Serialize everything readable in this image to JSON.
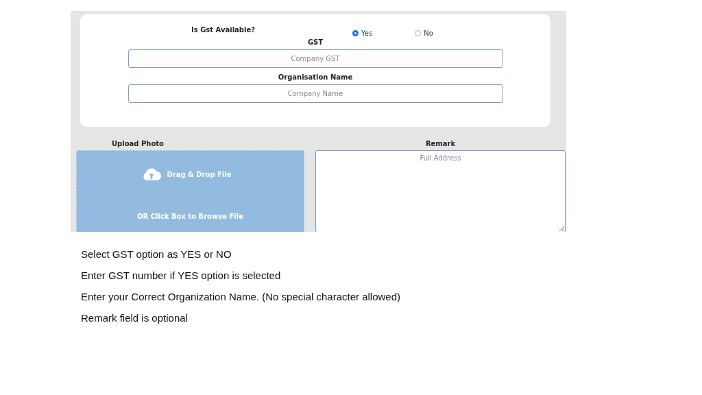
{
  "gst_question": {
    "label": "Is Gst Available?",
    "options": [
      {
        "label": "Yes",
        "selected": true
      },
      {
        "label": "No",
        "selected": false
      }
    ]
  },
  "gst_field": {
    "label": "GST",
    "placeholder": "Company GST"
  },
  "organisation_field": {
    "label": "Organisation Name",
    "placeholder": "Company Name"
  },
  "upload": {
    "label": "Upload Photo",
    "drop_text": "Drag & Drop File",
    "browse_text": "OR Click Box to Browse File"
  },
  "remark": {
    "label": "Remark",
    "placeholder": "Full Address"
  },
  "notes": [
    "Select GST option as YES or NO",
    "Enter GST number if YES option is selected",
    "Enter your Correct Organization Name. (No special character allowed)",
    "Remark field is optional"
  ]
}
